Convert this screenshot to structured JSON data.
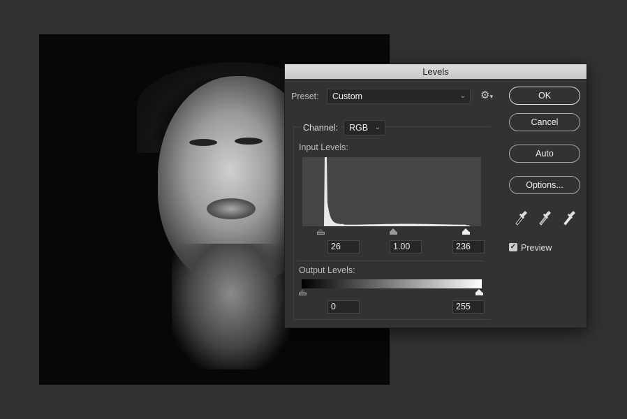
{
  "dialog": {
    "title": "Levels"
  },
  "preset": {
    "label": "Preset:",
    "value": "Custom"
  },
  "channel": {
    "label": "Channel:",
    "value": "RGB"
  },
  "input_levels": {
    "label": "Input Levels:",
    "black": "26",
    "gamma": "1.00",
    "white": "236"
  },
  "output_levels": {
    "label": "Output Levels:",
    "black": "0",
    "white": "255"
  },
  "buttons": {
    "ok": "OK",
    "cancel": "Cancel",
    "auto": "Auto",
    "options": "Options..."
  },
  "preview": {
    "label": "Preview",
    "checked": true
  },
  "icons": [
    "gear-icon",
    "black-eyedropper-icon",
    "gray-eyedropper-icon",
    "white-eyedropper-icon"
  ]
}
